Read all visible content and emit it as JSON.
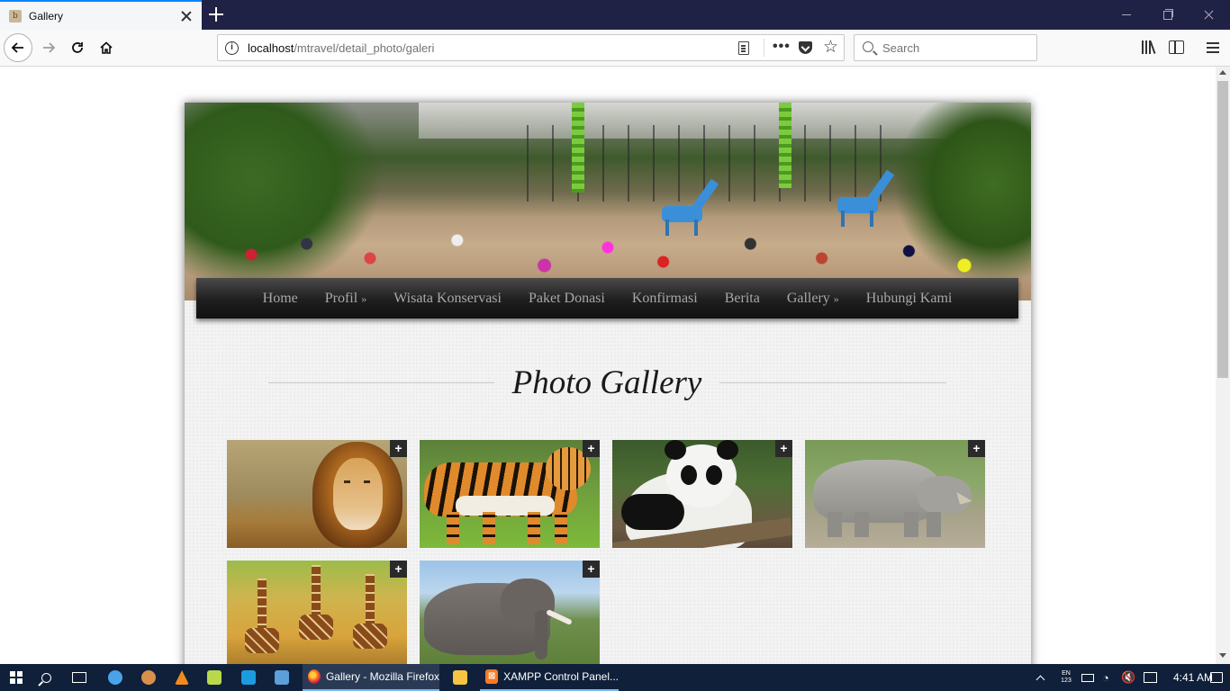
{
  "browser": {
    "tab_title": "Gallery",
    "tab_favicon": "b",
    "url_host": "localhost",
    "url_path": "/mtravel/detail_photo/galeri",
    "search_placeholder": "Search"
  },
  "site": {
    "menu": [
      {
        "label": "Home",
        "arrow": ""
      },
      {
        "label": "Profil",
        "arrow": "»"
      },
      {
        "label": "Wisata Konservasi",
        "arrow": ""
      },
      {
        "label": "Paket Donasi",
        "arrow": ""
      },
      {
        "label": "Konfirmasi",
        "arrow": ""
      },
      {
        "label": "Berita",
        "arrow": ""
      },
      {
        "label": "Gallery",
        "arrow": "»"
      },
      {
        "label": "Hubungi Kami",
        "arrow": ""
      }
    ],
    "gallery_title": "Photo Gallery",
    "photos": [
      {
        "subject": "lion",
        "plus": "+"
      },
      {
        "subject": "tiger",
        "plus": "+"
      },
      {
        "subject": "panda",
        "plus": "+"
      },
      {
        "subject": "rhino",
        "plus": "+"
      },
      {
        "subject": "giraffes",
        "plus": "+"
      },
      {
        "subject": "elephant",
        "plus": "+"
      }
    ]
  },
  "taskbar": {
    "firefox_label": "Gallery - Mozilla Firefox",
    "xampp_label": "XAMPP Control Panel...",
    "xampp_icon_text": "⊠",
    "tray_lang_top": "EN",
    "tray_lang_bottom": "123",
    "clock": "4:41 AM",
    "net_glyph": "◔",
    "vol_glyph": "🔇"
  }
}
